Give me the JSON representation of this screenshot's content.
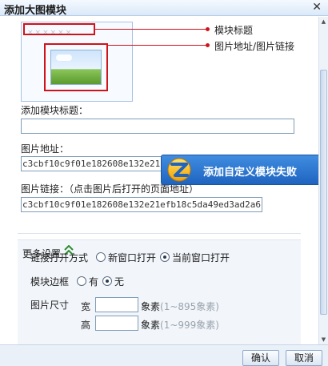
{
  "dialog": {
    "title": "添加大图模块"
  },
  "preview": {
    "placeholder_title": "××××××",
    "callouts": {
      "title_label": "模块标题",
      "image_label": "图片地址/图片链接"
    }
  },
  "form": {
    "module_title": {
      "label": "添加模块标题：",
      "value": ""
    },
    "image_url": {
      "label": "图片地址：",
      "value": "c3cbf10c9f01e182608e132e21"
    },
    "image_link": {
      "label": "图片链接：（点击图片后打开的页面地址）",
      "value": "c3cbf10c9f01e182608e132e21efb18c5da49ed3ad2a6"
    }
  },
  "popup": {
    "text": "添加自定义模块失败"
  },
  "more_settings": {
    "title": "更多设置",
    "link_open": {
      "label": "链接打开方式",
      "options": [
        "新窗口打开",
        "当前窗口打开"
      ],
      "selected": "当前窗口打开"
    },
    "border": {
      "label": "模块边框",
      "options": [
        "有",
        "无"
      ],
      "selected": "无"
    },
    "image_size": {
      "label": "图片尺寸",
      "width": {
        "label": "宽",
        "value": "",
        "unit": "象素",
        "hint": "(1~895象素)"
      },
      "height": {
        "label": "高",
        "value": "",
        "unit": "象素",
        "hint": "(1~999象素)"
      }
    }
  },
  "buttons": {
    "ok": "确认",
    "cancel": "取消"
  },
  "colors": {
    "highlight": "#d0121b",
    "popup_bg": "#2f78d0",
    "panel_bg": "#f2f6fb"
  }
}
